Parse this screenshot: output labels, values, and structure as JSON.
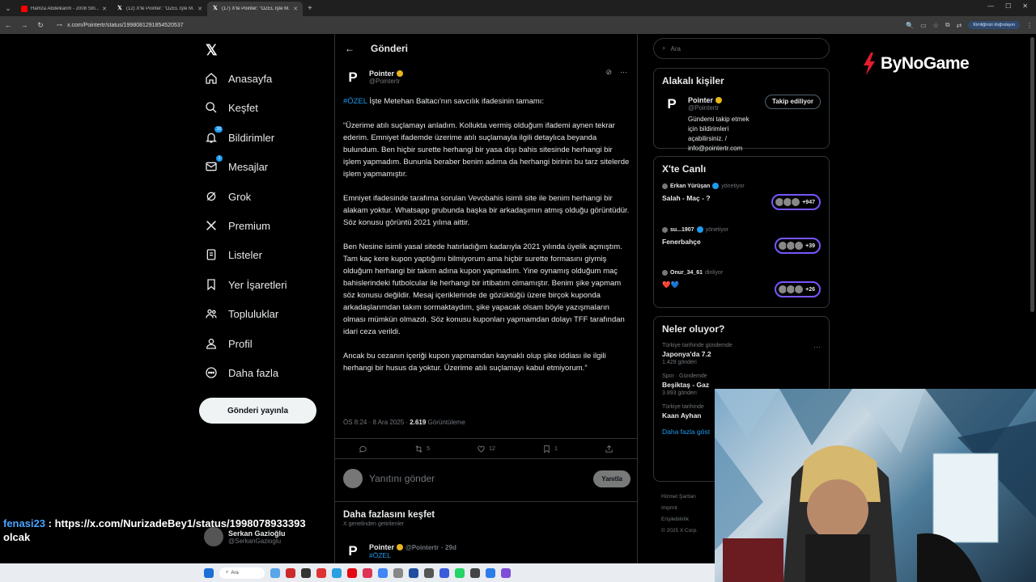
{
  "browser": {
    "tabs": [
      {
        "title": "Hamza Abdelkarim - 2008 Stri...",
        "favicon": "youtube-icon",
        "active": false
      },
      {
        "title": "(12) X'te Pointer: \"ÖZEL İşte M...",
        "favicon": "x-icon",
        "active": false
      },
      {
        "title": "(17) X'te Pointer: \"ÖZEL İşte M...",
        "favicon": "x-icon",
        "active": true
      }
    ],
    "url": "x.com/Pointertr/status/1998081291854520537",
    "profile_label": "Kimliğinizi doğrulayın"
  },
  "sidebar": {
    "items": [
      {
        "label": "Anasayfa",
        "icon": "home-icon"
      },
      {
        "label": "Keşfet",
        "icon": "search-icon"
      },
      {
        "label": "Bildirimler",
        "icon": "bell-icon",
        "badge": "16"
      },
      {
        "label": "Mesajlar",
        "icon": "mail-icon",
        "badge": "1"
      },
      {
        "label": "Grok",
        "icon": "grok-icon"
      },
      {
        "label": "Premium",
        "icon": "x-premium-icon"
      },
      {
        "label": "Listeler",
        "icon": "list-icon"
      },
      {
        "label": "Yer İşaretleri",
        "icon": "bookmark-icon"
      },
      {
        "label": "Topluluklar",
        "icon": "people-icon"
      },
      {
        "label": "Profil",
        "icon": "person-icon"
      },
      {
        "label": "Daha fazla",
        "icon": "more-circle-icon"
      }
    ],
    "post_button": "Gönderi yayınla",
    "user": {
      "name": "Serkan Gazioğlu",
      "handle": "@SerkanGazioglu"
    }
  },
  "main": {
    "title": "Gönderi",
    "author": {
      "name": "Pointer",
      "handle": "@Pointertr"
    },
    "body": {
      "tag": "#ÖZEL",
      "intro": " İşte Metehan Baltacı'nın savcılık ifadesinin tamamı:",
      "p1": "“Üzerime atılı suçlamayı anladım. Kollukta vermiş olduğum ifademi aynen tekrar ederim. Emniyet ifademde üzerime atılı suçlamayla ilgili detaylıca beyanda bulundum. Ben hiçbir surette herhangi bir yasa dışı bahis sitesinde herhangi bir işlem yapmadım. Bununla beraber benim adıma da herhangi birinin bu tarz sitelerde işlem yapmamıştır.",
      "p2": "Emniyet ifadesinde tarafıma sorulan Vevobahis isimli site ile benim herhangi bir alakam yoktur. Whatsapp grubunda başka bir arkadaşımın atmış olduğu görüntüdür. Söz konusu görüntü 2021 yılına aittir.",
      "p3": "Ben Nesine isimli yasal sitede hatırladığım kadarıyla 2021 yılında üyelik açmıştım. Tam kaç kere kupon yaptığımı bilmiyorum ama hiçbir surette formasını giymiş olduğum herhangi bir takım adına kupon yapmadım. Yine oynamış olduğum maç bahislerindeki futbolcular ile herhangi bir irtibatım olmamıştır. Benim şike yapmam söz konusu değildir. Mesaj içeriklerinde de gözüktüğü üzere birçok kuponda arkadaşlarımdan takım sormaktaydım, şike yapacak olsam böyle yazışmaların olması mümkün olmazdı. Söz konusu kuponları yapmamdan dolayı TFF tarafından idari ceza verildi.",
      "p4": "Ancak bu cezanın içeriği kupon yapmamdan kaynaklı olup şike iddiası ile ilgili herhangi bir husus da yoktur. Üzerime atılı suçlamayı kabul etmiyorum.”"
    },
    "meta": {
      "time": "ÖS 8:24 · 8 Ara 2025 · ",
      "views": "2.619",
      "views_label": " Görüntüleme"
    },
    "actions": {
      "reposts": "5",
      "likes": "12",
      "bookmarks": "1"
    },
    "reply_placeholder": "Yanıtını gönder",
    "reply_button": "Yanıtla",
    "discover": {
      "title": "Daha fazlasını keşfet",
      "subtitle": "X genelinden getirilenler"
    },
    "mini_post": {
      "name": "Pointer",
      "handle": "@Pointertr",
      "age": "· 29d",
      "tag": "#ÖZEL"
    }
  },
  "right": {
    "search_placeholder": "Ara",
    "related": {
      "title": "Alakalı kişiler",
      "name": "Pointer",
      "handle": "@Pointertr",
      "button": "Takip ediliyor",
      "desc": "Gündemi takip etmek için bildirimleri açabilirsiniz. / info@pointertr.com"
    },
    "live": {
      "title": "X'te Canlı",
      "items": [
        {
          "host": "Erkan Yürüşan",
          "role": "yönetiyor",
          "title": "Salah - Maç - ?",
          "count": "+947"
        },
        {
          "host": "su...1907",
          "role": "yönetiyor",
          "title": "Fenerbahçe",
          "count": "+39"
        },
        {
          "host": "Onur_34_61",
          "role": "dinliyor",
          "title": "❤️💙",
          "count": "+26"
        }
      ]
    },
    "trends": {
      "title": "Neler oluyor?",
      "items": [
        {
          "category": "Türkiye tarihinde gündemde",
          "name": "Japonya'da 7.2",
          "count": "1.429 gönderi"
        },
        {
          "category": "Spor · Gündemde",
          "name": "Beşiktaş - Gaz",
          "count": "3.893 gönderi"
        },
        {
          "category": "Türkiye tarihinde",
          "name": "Kaan Ayhan",
          "count": ""
        }
      ],
      "show_more": "Daha fazla göst"
    },
    "footer": [
      "Hizmet Şartları",
      "Imprint",
      "Erişilebilirlik",
      "© 2025 X Corp."
    ]
  },
  "brand": {
    "name": "ByNoGame"
  },
  "chat": {
    "user": "fenasi23",
    "message": " : https://x.com/NurizadeBey1/status/1998078933393",
    "message2": "olcak"
  },
  "taskbar": {
    "search": "Ara"
  }
}
